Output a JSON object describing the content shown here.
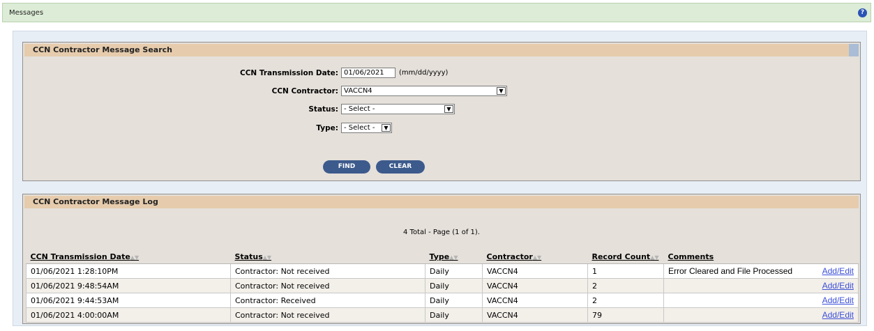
{
  "topbar": {
    "title": "Messages",
    "help_icon": "help-icon"
  },
  "search": {
    "title": "CCN Contractor Message Search",
    "date_label": "CCN Transmission Date:",
    "date_value": "01/06/2021",
    "date_hint": "(mm/dd/yyyy)",
    "contractor_label": "CCN Contractor:",
    "contractor_value": "VACCN4",
    "status_label": "Status:",
    "status_value": "- Select -",
    "type_label": "Type:",
    "type_value": "- Select -",
    "find_label": "FIND",
    "clear_label": "CLEAR"
  },
  "log": {
    "title": "CCN Contractor Message Log",
    "count_text": "4 Total - Page (1 of 1).",
    "headers": [
      "CCN Transmission Date",
      "Status",
      "Type",
      "Contractor",
      "Record Count",
      "Comments"
    ],
    "rows": [
      {
        "date": "01/06/2021 1:28:10PM",
        "status": "Contractor: Not received",
        "type": "Daily",
        "contractor": "VACCN4",
        "count": "1",
        "comment": "Error Cleared and File Processed",
        "action": "Add/Edit"
      },
      {
        "date": "01/06/2021 9:48:54AM",
        "status": "Contractor: Not received",
        "type": "Daily",
        "contractor": "VACCN4",
        "count": "2",
        "comment": "",
        "action": "Add/Edit"
      },
      {
        "date": "01/06/2021 9:44:53AM",
        "status": "Contractor: Received",
        "type": "Daily",
        "contractor": "VACCN4",
        "count": "2",
        "comment": "",
        "action": "Add/Edit"
      },
      {
        "date": "01/06/2021 4:00:00AM",
        "status": "Contractor: Not received",
        "type": "Daily",
        "contractor": "VACCN4",
        "count": "79",
        "comment": "",
        "action": "Add/Edit"
      }
    ]
  }
}
